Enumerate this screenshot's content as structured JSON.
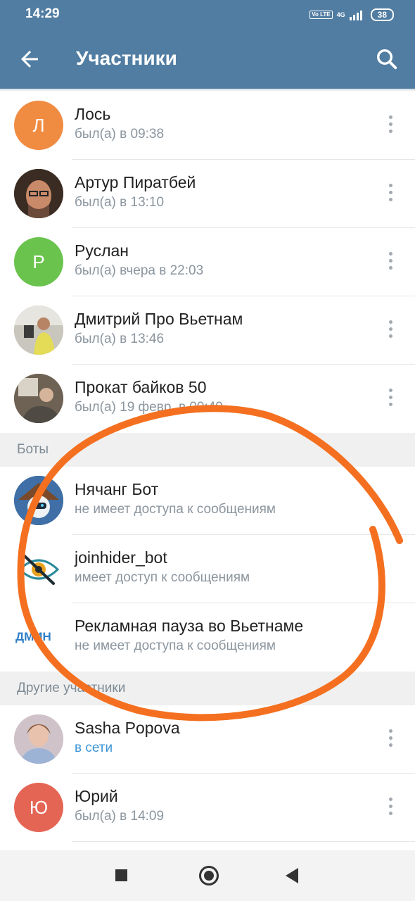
{
  "status_bar": {
    "time": "14:29",
    "volte": "Vo LTE",
    "network": "4G",
    "battery": "38"
  },
  "header": {
    "title": "Участники",
    "back_icon": "arrow-left-icon",
    "search_icon": "search-icon"
  },
  "members_top": [
    {
      "name": "Лось",
      "status": "был(а) в 09:38",
      "avatar": {
        "type": "letter",
        "letter": "Л",
        "color": "#f08c42"
      }
    },
    {
      "name": "Артур Пиратбей",
      "status": "был(а) в 13:10",
      "avatar": {
        "type": "photo",
        "color": "#7a5a44"
      }
    },
    {
      "name": "Руслан",
      "status": "был(а) вчера в 22:03",
      "avatar": {
        "type": "letter",
        "letter": "Р",
        "color": "#6ac34d"
      }
    },
    {
      "name": "Дмитрий Про Вьетнам",
      "status": "был(а) в 13:46",
      "avatar": {
        "type": "photo",
        "color": "#b9b39a"
      }
    },
    {
      "name": "Прокат байков 50",
      "status": "был(а) 19 февр. в 00:49",
      "avatar": {
        "type": "photo",
        "color": "#8a7c6c"
      }
    }
  ],
  "bots_section": {
    "label": "Боты",
    "items": [
      {
        "name": "Нячанг Бот",
        "status": "не имеет доступа к сообщениям",
        "avatar": {
          "type": "robot-icon"
        }
      },
      {
        "name": "joinhider_bot",
        "status": "имеет доступ к сообщениям",
        "avatar": {
          "type": "eye-slash-icon"
        }
      },
      {
        "name": "Рекламная пауза во Вьетнаме",
        "status": "не имеет доступа к сообщениям",
        "avatar": {
          "type": "text",
          "text": "ДМИН"
        }
      }
    ]
  },
  "others_section": {
    "label": "Другие участники",
    "items": [
      {
        "name": "Sasha Popova",
        "status": "в сети",
        "online": true,
        "avatar": {
          "type": "photo",
          "color": "#c9a79a"
        }
      },
      {
        "name": "Юрий",
        "status": "был(а) в 14:09",
        "avatar": {
          "type": "letter",
          "letter": "Ю",
          "color": "#e56555"
        }
      }
    ]
  },
  "colors": {
    "header": "#517da2",
    "annotation_circle": "#f47020",
    "online": "#3d95d5"
  },
  "nav_bar": {
    "recents_icon": "square-icon",
    "home_icon": "circle-icon",
    "back_icon": "triangle-back-icon"
  }
}
